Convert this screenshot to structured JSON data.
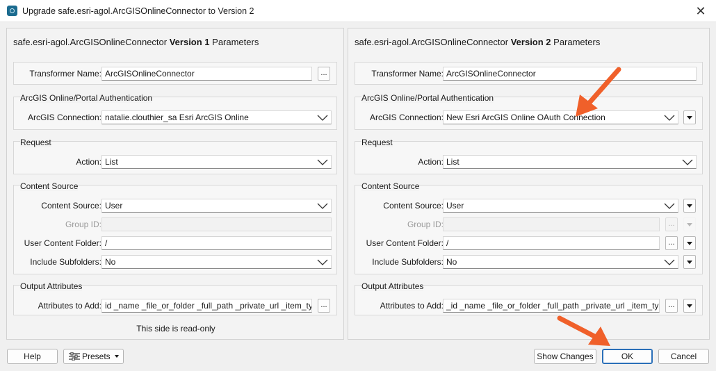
{
  "window": {
    "title": "Upgrade safe.esri-agol.ArcGISOnlineConnector to Version 2",
    "close_glyph": "✕"
  },
  "left": {
    "heading_prefix": "safe.esri-agol.ArcGISOnlineConnector ",
    "heading_version": "Version 1",
    "heading_suffix": " Parameters",
    "transformer_name_label": "Transformer Name:",
    "transformer_name_value": "ArcGISOnlineConnector",
    "auth_group": "ArcGIS Online/Portal Authentication",
    "connection_label": "ArcGIS Connection:",
    "connection_value": "natalie.clouthier_sa Esri ArcGIS Online",
    "request_group": "Request",
    "action_label": "Action:",
    "action_value": "List",
    "content_group": "Content Source",
    "content_source_label": "Content Source:",
    "content_source_value": "User",
    "group_id_label": "Group ID:",
    "group_id_value": "",
    "user_folder_label": "User Content Folder:",
    "user_folder_value": "/",
    "include_subfolders_label": "Include Subfolders:",
    "include_subfolders_value": "No",
    "output_group": "Output Attributes",
    "attributes_label": "Attributes to Add:",
    "attributes_value": "id _name _file_or_folder _full_path _private_url _item_type",
    "readonly_note": "This side is read-only",
    "ellipsis": "..."
  },
  "right": {
    "heading_prefix": "safe.esri-agol.ArcGISOnlineConnector ",
    "heading_version": "Version 2",
    "heading_suffix": " Parameters",
    "transformer_name_label": "Transformer Name:",
    "transformer_name_value": "ArcGISOnlineConnector",
    "auth_group": "ArcGIS Online/Portal Authentication",
    "connection_label": "ArcGIS Connection:",
    "connection_value": "New Esri ArcGIS Online OAuth Connection",
    "request_group": "Request",
    "action_label": "Action:",
    "action_value": "List",
    "content_group": "Content Source",
    "content_source_label": "Content Source:",
    "content_source_value": "User",
    "group_id_label": "Group ID:",
    "group_id_value": "",
    "user_folder_label": "User Content Folder:",
    "user_folder_value": "/",
    "include_subfolders_label": "Include Subfolders:",
    "include_subfolders_value": "No",
    "output_group": "Output Attributes",
    "attributes_label": "Attributes to Add:",
    "attributes_value": "_id _name _file_or_folder _full_path _private_url _item_type",
    "ellipsis": "..."
  },
  "footer": {
    "help_label": "Help",
    "presets_label": "Presets",
    "show_changes_label": "Show Changes",
    "ok_label": "OK",
    "cancel_label": "Cancel"
  },
  "colors": {
    "annotation_arrow": "#f0602a",
    "primary_button_border": "#2a6fb8"
  }
}
